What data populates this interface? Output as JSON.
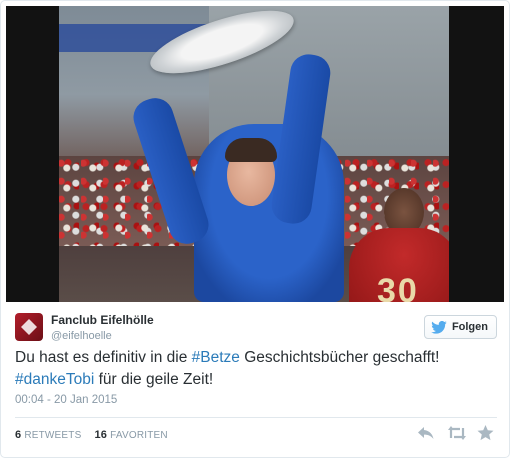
{
  "tweet": {
    "author_name": "Fanclub Eifelhölle",
    "author_handle": "@eifelhoelle",
    "follow_label": "Folgen",
    "text_segments": [
      {
        "type": "text",
        "value": "Du hast es definitiv in die "
      },
      {
        "type": "hashtag",
        "value": "#Betze"
      },
      {
        "type": "text",
        "value": " Geschichtsbücher geschafft!"
      },
      {
        "type": "break"
      },
      {
        "type": "hashtag",
        "value": "#dankeTobi"
      },
      {
        "type": "text",
        "value": " für die geile Zeit!"
      }
    ],
    "timestamp": "00:04 - 20 Jan 2015",
    "retweets_count": "6",
    "retweets_label": "RETWEETS",
    "favorites_count": "16",
    "favorites_label": "FAVORITEN",
    "photo_jersey_text": "30",
    "colors": {
      "hashtag": "#2b7bb9",
      "text": "#292f33",
      "meta": "#8899a6",
      "twitter_blue": "#55acee"
    },
    "icons": [
      "twitter-bird-icon",
      "reply-icon",
      "retweet-icon",
      "favorite-star-icon"
    ]
  }
}
